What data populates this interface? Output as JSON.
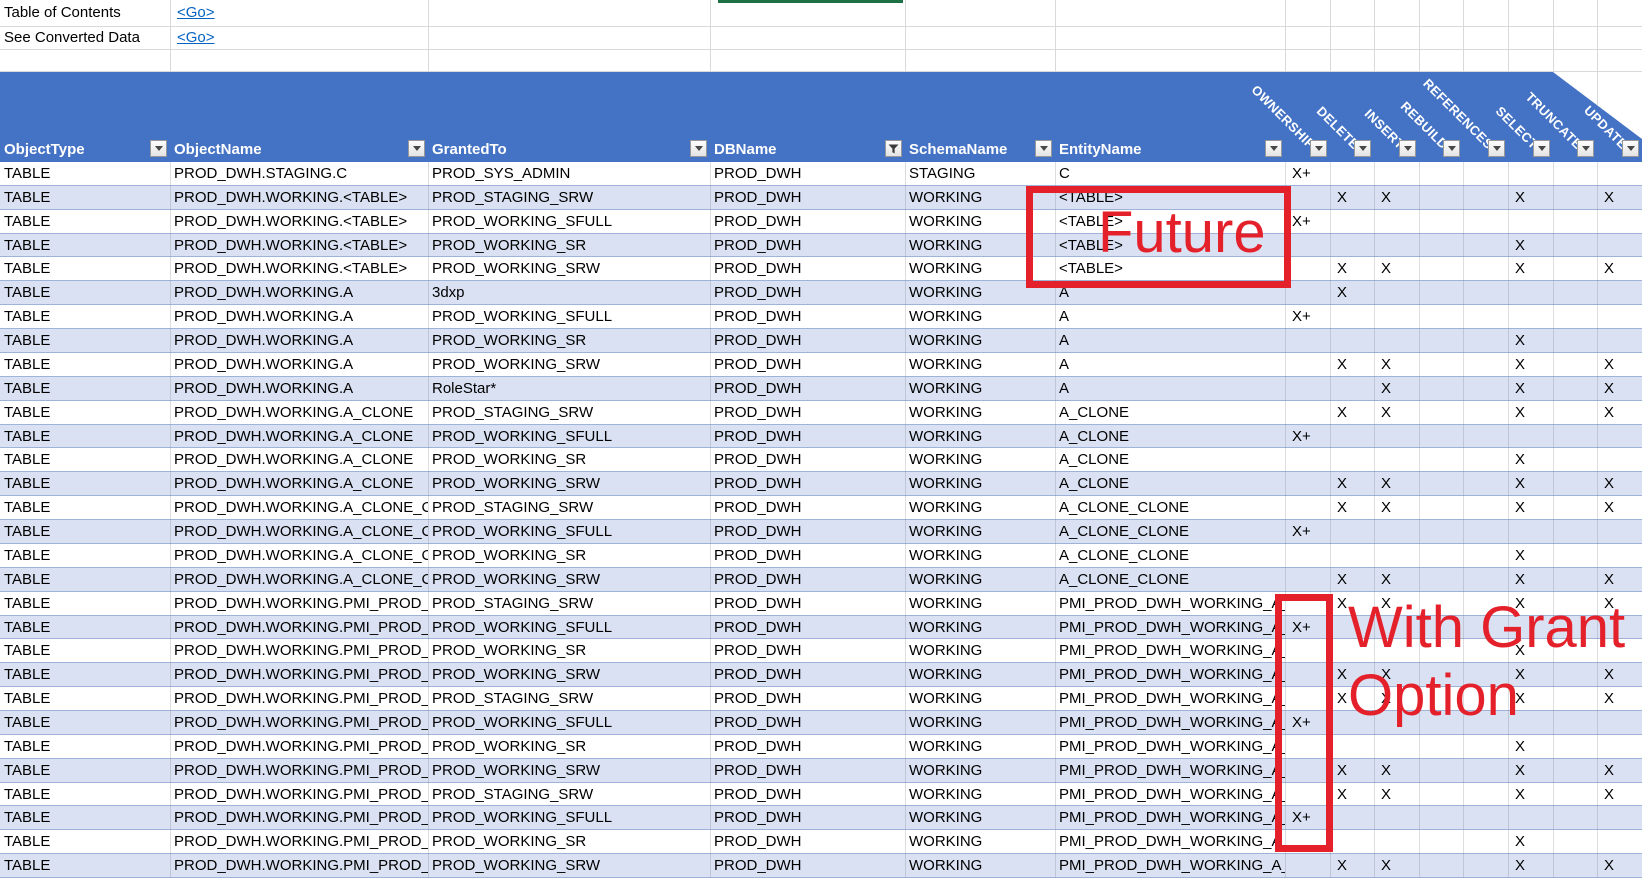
{
  "quick_links": [
    {
      "label": "Table of Contents",
      "link_text": "<Go>"
    },
    {
      "label": "See Converted Data",
      "link_text": "<Go>"
    }
  ],
  "table": {
    "columns": [
      {
        "label": "ObjectType",
        "filter": "dropdown"
      },
      {
        "label": "ObjectName",
        "filter": "dropdown"
      },
      {
        "label": "GrantedTo",
        "filter": "dropdown"
      },
      {
        "label": "DBName",
        "filter": "funnel"
      },
      {
        "label": "SchemaName",
        "filter": "dropdown"
      },
      {
        "label": "EntityName",
        "filter": "dropdown"
      }
    ],
    "permission_columns": [
      "OWNERSHIP",
      "DELETE",
      "INSERT",
      "REBUILD",
      "REFERENCES",
      "SELECT",
      "TRUNCATE",
      "UPDATE"
    ],
    "rows": [
      {
        "objectType": "TABLE",
        "objectName": "PROD_DWH.STAGING.C",
        "grantedTo": "PROD_SYS_ADMIN",
        "dbName": "PROD_DWH",
        "schemaName": "STAGING",
        "entityName": "C",
        "perms": {
          "OWNERSHIP": "X+"
        }
      },
      {
        "objectType": "TABLE",
        "objectName": "PROD_DWH.WORKING.<TABLE>",
        "grantedTo": "PROD_STAGING_SRW",
        "dbName": "PROD_DWH",
        "schemaName": "WORKING",
        "entityName": "<TABLE>",
        "perms": {
          "DELETE": "X",
          "INSERT": "X",
          "SELECT": "X",
          "UPDATE": "X"
        }
      },
      {
        "objectType": "TABLE",
        "objectName": "PROD_DWH.WORKING.<TABLE>",
        "grantedTo": "PROD_WORKING_SFULL",
        "dbName": "PROD_DWH",
        "schemaName": "WORKING",
        "entityName": "<TABLE>",
        "perms": {
          "OWNERSHIP": "X+"
        }
      },
      {
        "objectType": "TABLE",
        "objectName": "PROD_DWH.WORKING.<TABLE>",
        "grantedTo": "PROD_WORKING_SR",
        "dbName": "PROD_DWH",
        "schemaName": "WORKING",
        "entityName": "<TABLE>",
        "perms": {
          "SELECT": "X"
        }
      },
      {
        "objectType": "TABLE",
        "objectName": "PROD_DWH.WORKING.<TABLE>",
        "grantedTo": "PROD_WORKING_SRW",
        "dbName": "PROD_DWH",
        "schemaName": "WORKING",
        "entityName": "<TABLE>",
        "perms": {
          "DELETE": "X",
          "INSERT": "X",
          "SELECT": "X",
          "UPDATE": "X"
        }
      },
      {
        "objectType": "TABLE",
        "objectName": "PROD_DWH.WORKING.A",
        "grantedTo": "3dxp",
        "dbName": "PROD_DWH",
        "schemaName": "WORKING",
        "entityName": "A",
        "perms": {
          "DELETE": "X"
        }
      },
      {
        "objectType": "TABLE",
        "objectName": "PROD_DWH.WORKING.A",
        "grantedTo": "PROD_WORKING_SFULL",
        "dbName": "PROD_DWH",
        "schemaName": "WORKING",
        "entityName": "A",
        "perms": {
          "OWNERSHIP": "X+"
        }
      },
      {
        "objectType": "TABLE",
        "objectName": "PROD_DWH.WORKING.A",
        "grantedTo": "PROD_WORKING_SR",
        "dbName": "PROD_DWH",
        "schemaName": "WORKING",
        "entityName": "A",
        "perms": {
          "SELECT": "X"
        }
      },
      {
        "objectType": "TABLE",
        "objectName": "PROD_DWH.WORKING.A",
        "grantedTo": "PROD_WORKING_SRW",
        "dbName": "PROD_DWH",
        "schemaName": "WORKING",
        "entityName": "A",
        "perms": {
          "DELETE": "X",
          "INSERT": "X",
          "SELECT": "X",
          "UPDATE": "X"
        }
      },
      {
        "objectType": "TABLE",
        "objectName": "PROD_DWH.WORKING.A",
        "grantedTo": "RoleStar*",
        "dbName": "PROD_DWH",
        "schemaName": "WORKING",
        "entityName": "A",
        "perms": {
          "INSERT": "X",
          "SELECT": "X",
          "UPDATE": "X"
        }
      },
      {
        "objectType": "TABLE",
        "objectName": "PROD_DWH.WORKING.A_CLONE",
        "grantedTo": "PROD_STAGING_SRW",
        "dbName": "PROD_DWH",
        "schemaName": "WORKING",
        "entityName": "A_CLONE",
        "perms": {
          "DELETE": "X",
          "INSERT": "X",
          "SELECT": "X",
          "UPDATE": "X"
        }
      },
      {
        "objectType": "TABLE",
        "objectName": "PROD_DWH.WORKING.A_CLONE",
        "grantedTo": "PROD_WORKING_SFULL",
        "dbName": "PROD_DWH",
        "schemaName": "WORKING",
        "entityName": "A_CLONE",
        "perms": {
          "OWNERSHIP": "X+"
        }
      },
      {
        "objectType": "TABLE",
        "objectName": "PROD_DWH.WORKING.A_CLONE",
        "grantedTo": "PROD_WORKING_SR",
        "dbName": "PROD_DWH",
        "schemaName": "WORKING",
        "entityName": "A_CLONE",
        "perms": {
          "SELECT": "X"
        }
      },
      {
        "objectType": "TABLE",
        "objectName": "PROD_DWH.WORKING.A_CLONE",
        "grantedTo": "PROD_WORKING_SRW",
        "dbName": "PROD_DWH",
        "schemaName": "WORKING",
        "entityName": "A_CLONE",
        "perms": {
          "DELETE": "X",
          "INSERT": "X",
          "SELECT": "X",
          "UPDATE": "X"
        }
      },
      {
        "objectType": "TABLE",
        "objectName": "PROD_DWH.WORKING.A_CLONE_CLONE",
        "grantedTo": "PROD_STAGING_SRW",
        "dbName": "PROD_DWH",
        "schemaName": "WORKING",
        "entityName": "A_CLONE_CLONE",
        "perms": {
          "DELETE": "X",
          "INSERT": "X",
          "SELECT": "X",
          "UPDATE": "X"
        }
      },
      {
        "objectType": "TABLE",
        "objectName": "PROD_DWH.WORKING.A_CLONE_CLONE",
        "grantedTo": "PROD_WORKING_SFULL",
        "dbName": "PROD_DWH",
        "schemaName": "WORKING",
        "entityName": "A_CLONE_CLONE",
        "perms": {
          "OWNERSHIP": "X+"
        }
      },
      {
        "objectType": "TABLE",
        "objectName": "PROD_DWH.WORKING.A_CLONE_CLONE",
        "grantedTo": "PROD_WORKING_SR",
        "dbName": "PROD_DWH",
        "schemaName": "WORKING",
        "entityName": "A_CLONE_CLONE",
        "perms": {
          "SELECT": "X"
        }
      },
      {
        "objectType": "TABLE",
        "objectName": "PROD_DWH.WORKING.A_CLONE_CLONE",
        "grantedTo": "PROD_WORKING_SRW",
        "dbName": "PROD_DWH",
        "schemaName": "WORKING",
        "entityName": "A_CLONE_CLONE",
        "perms": {
          "DELETE": "X",
          "INSERT": "X",
          "SELECT": "X",
          "UPDATE": "X"
        }
      },
      {
        "objectType": "TABLE",
        "objectName": "PROD_DWH.WORKING.PMI_PROD_DWH_WORKING_A_CLONE_CLONE",
        "grantedTo": "PROD_STAGING_SRW",
        "dbName": "PROD_DWH",
        "schemaName": "WORKING",
        "entityName": "PMI_PROD_DWH_WORKING_A_CLONE_CLONE",
        "perms": {
          "DELETE": "X",
          "INSERT": "X",
          "SELECT": "X",
          "UPDATE": "X"
        }
      },
      {
        "objectType": "TABLE",
        "objectName": "PROD_DWH.WORKING.PMI_PROD_DWH_WORKING_A_CLONE_CLONE",
        "grantedTo": "PROD_WORKING_SFULL",
        "dbName": "PROD_DWH",
        "schemaName": "WORKING",
        "entityName": "PMI_PROD_DWH_WORKING_A_CLONE_CLONE",
        "perms": {
          "OWNERSHIP": "X+"
        }
      },
      {
        "objectType": "TABLE",
        "objectName": "PROD_DWH.WORKING.PMI_PROD_DWH_WORKING_A_CLONE_CLONE",
        "grantedTo": "PROD_WORKING_SR",
        "dbName": "PROD_DWH",
        "schemaName": "WORKING",
        "entityName": "PMI_PROD_DWH_WORKING_A_CLONE_CLONE",
        "perms": {
          "SELECT": "X"
        }
      },
      {
        "objectType": "TABLE",
        "objectName": "PROD_DWH.WORKING.PMI_PROD_DWH_WORKING_A_CLONE_CLONE",
        "grantedTo": "PROD_WORKING_SRW",
        "dbName": "PROD_DWH",
        "schemaName": "WORKING",
        "entityName": "PMI_PROD_DWH_WORKING_A_CLONE_CLONE",
        "perms": {
          "DELETE": "X",
          "INSERT": "X",
          "SELECT": "X",
          "UPDATE": "X"
        }
      },
      {
        "objectType": "TABLE",
        "objectName": "PROD_DWH.WORKING.PMI_PROD_DWH_WORKING_A_CLONE_CLONE",
        "grantedTo": "PROD_STAGING_SRW",
        "dbName": "PROD_DWH",
        "schemaName": "WORKING",
        "entityName": "PMI_PROD_DWH_WORKING_A_CLONE_CLONE",
        "perms": {
          "DELETE": "X",
          "INSERT": "X",
          "SELECT": "X",
          "UPDATE": "X"
        }
      },
      {
        "objectType": "TABLE",
        "objectName": "PROD_DWH.WORKING.PMI_PROD_DWH_WORKING_A_CLONE_CLONE",
        "grantedTo": "PROD_WORKING_SFULL",
        "dbName": "PROD_DWH",
        "schemaName": "WORKING",
        "entityName": "PMI_PROD_DWH_WORKING_A_CLONE_CLONE",
        "perms": {
          "OWNERSHIP": "X+"
        }
      },
      {
        "objectType": "TABLE",
        "objectName": "PROD_DWH.WORKING.PMI_PROD_DWH_WORKING_A_CLONE_CLONE",
        "grantedTo": "PROD_WORKING_SR",
        "dbName": "PROD_DWH",
        "schemaName": "WORKING",
        "entityName": "PMI_PROD_DWH_WORKING_A_CLONE_CLONE",
        "perms": {
          "SELECT": "X"
        }
      },
      {
        "objectType": "TABLE",
        "objectName": "PROD_DWH.WORKING.PMI_PROD_DWH_WORKING_A_CLONE_CLONE",
        "grantedTo": "PROD_WORKING_SRW",
        "dbName": "PROD_DWH",
        "schemaName": "WORKING",
        "entityName": "PMI_PROD_DWH_WORKING_A_CLONE_CLONE",
        "perms": {
          "DELETE": "X",
          "INSERT": "X",
          "SELECT": "X",
          "UPDATE": "X"
        }
      },
      {
        "objectType": "TABLE",
        "objectName": "PROD_DWH.WORKING.PMI_PROD_DWH_WORKING_A_CLONE_CLONE",
        "grantedTo": "PROD_STAGING_SRW",
        "dbName": "PROD_DWH",
        "schemaName": "WORKING",
        "entityName": "PMI_PROD_DWH_WORKING_A_CLONE_CLONE",
        "perms": {
          "DELETE": "X",
          "INSERT": "X",
          "SELECT": "X",
          "UPDATE": "X"
        }
      },
      {
        "objectType": "TABLE",
        "objectName": "PROD_DWH.WORKING.PMI_PROD_DWH_WORKING_A_CLONE_CLONE",
        "grantedTo": "PROD_WORKING_SFULL",
        "dbName": "PROD_DWH",
        "schemaName": "WORKING",
        "entityName": "PMI_PROD_DWH_WORKING_A_CLONE_CLONE",
        "perms": {
          "OWNERSHIP": "X+"
        }
      },
      {
        "objectType": "TABLE",
        "objectName": "PROD_DWH.WORKING.PMI_PROD_DWH_WORKING_A_CLONE_CLONE",
        "grantedTo": "PROD_WORKING_SR",
        "dbName": "PROD_DWH",
        "schemaName": "WORKING",
        "entityName": "PMI_PROD_DWH_WORKING_A_CLONE_CLONE",
        "perms": {
          "SELECT": "X"
        }
      },
      {
        "objectType": "TABLE",
        "objectName": "PROD_DWH.WORKING.PMI_PROD_DWH_WORKING_A_CLONE_CLONE",
        "grantedTo": "PROD_WORKING_SRW",
        "dbName": "PROD_DWH",
        "schemaName": "WORKING",
        "entityName": "PMI_PROD_DWH_WORKING_A_CLONE_CLONE",
        "perms": {
          "DELETE": "X",
          "INSERT": "X",
          "SELECT": "X",
          "UPDATE": "X"
        }
      }
    ]
  },
  "annotations": {
    "future_label": "Future",
    "with_grant_line1": "With Grant",
    "with_grant_line2": "Option"
  },
  "colors": {
    "header_blue": "#4472C4",
    "banded_row_blue": "#D9E1F2",
    "annotation_red": "#E4212B",
    "link_blue": "#0563C1",
    "active_cell_green": "#1E7145"
  }
}
